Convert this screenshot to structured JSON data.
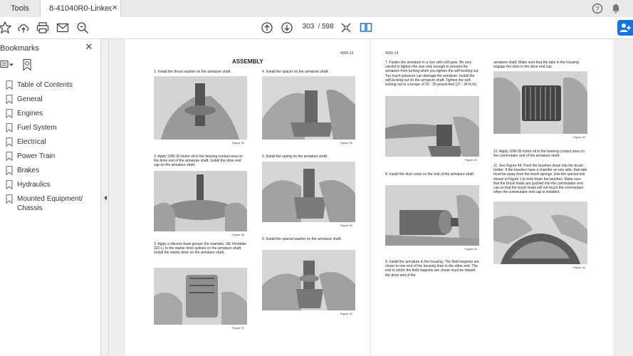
{
  "tabs": {
    "tools": "Tools",
    "document": "8-41040R0-Linked ..."
  },
  "toolbar": {
    "current_page": "303",
    "page_sep": "/",
    "total_pages": "598"
  },
  "bookmarks": {
    "title": "Bookmarks",
    "items": [
      {
        "label": "Table of Contents"
      },
      {
        "label": "General"
      },
      {
        "label": "Engines"
      },
      {
        "label": "Fuel System"
      },
      {
        "label": "Electrical"
      },
      {
        "label": "Power Train"
      },
      {
        "label": "Brakes"
      },
      {
        "label": "Hydraulics"
      },
      {
        "label": "Mounted Equipment/ Chassis"
      }
    ]
  },
  "left_page": {
    "page_number": "4006-13",
    "heading": "ASSEMBLY",
    "steps": [
      "1.  Install the thrust washer on the armature shaft.",
      "4.  Install the spacer on the armature shaft.",
      "2.  Apply 10W-30 motor oil to the bearing contact area on the drive end of the armature shaft. Install the drive end cap on the armature shaft.",
      "5.  Install the spring on the armature shaft.",
      "3.  Apply a silicone base grease (for example, GE Versilube 322-L) to the starter drive splines on the armature shaft. Install the starter drive on the armature shaft.",
      "6.  Install the special washer on the armature shaft."
    ],
    "figures": [
      "Figure 35",
      "Figure 36",
      "Figure 38",
      "Figure 39",
      "Figure 37",
      "Figure 40"
    ]
  },
  "right_page": {
    "page_number": "4006-14",
    "steps": [
      "7.  Fasten the armature in a vise with soft jaws. Be very careful to tighten the vise only enough to prevent the armature from turning when you tighten the self-locking nut. Too much pressure can damage the armature. Install the self-locking nut on the armature shaft. Tighten the self-locking nut to a torque of 20 - 25 pound-feet (27 - 34 N.m).",
      "armature shaft. Make sure that the tabs in the housing engage the slots in the drive end cap.",
      "8.  Install the dust cover on the end of the armature shaft.",
      "10.  Apply 10W-30 motor oil to the bearing contact area on the commutator end of the armature shaft.",
      "11.  See Figure 44. Push the brushes down into the brush holder. If the brushes have a chamfer on one side, that side must be away from the brush springs. Use the special tool shown in Figure 1 to hold down the brushes. Make sure that the brush leads are pushed into the commutator end cap so that the brush leads will not touch the commutator when the commutator end cap is installed.",
      "9.  Install the armature in the housing. The field magnets are closer to one end of the housing than to the other end. The end to which the field magnets are closer must be toward the drive end of the"
    ],
    "figures": [
      "Figure 41",
      "Figure 43",
      "Figure 42",
      "Figure 44"
    ]
  }
}
